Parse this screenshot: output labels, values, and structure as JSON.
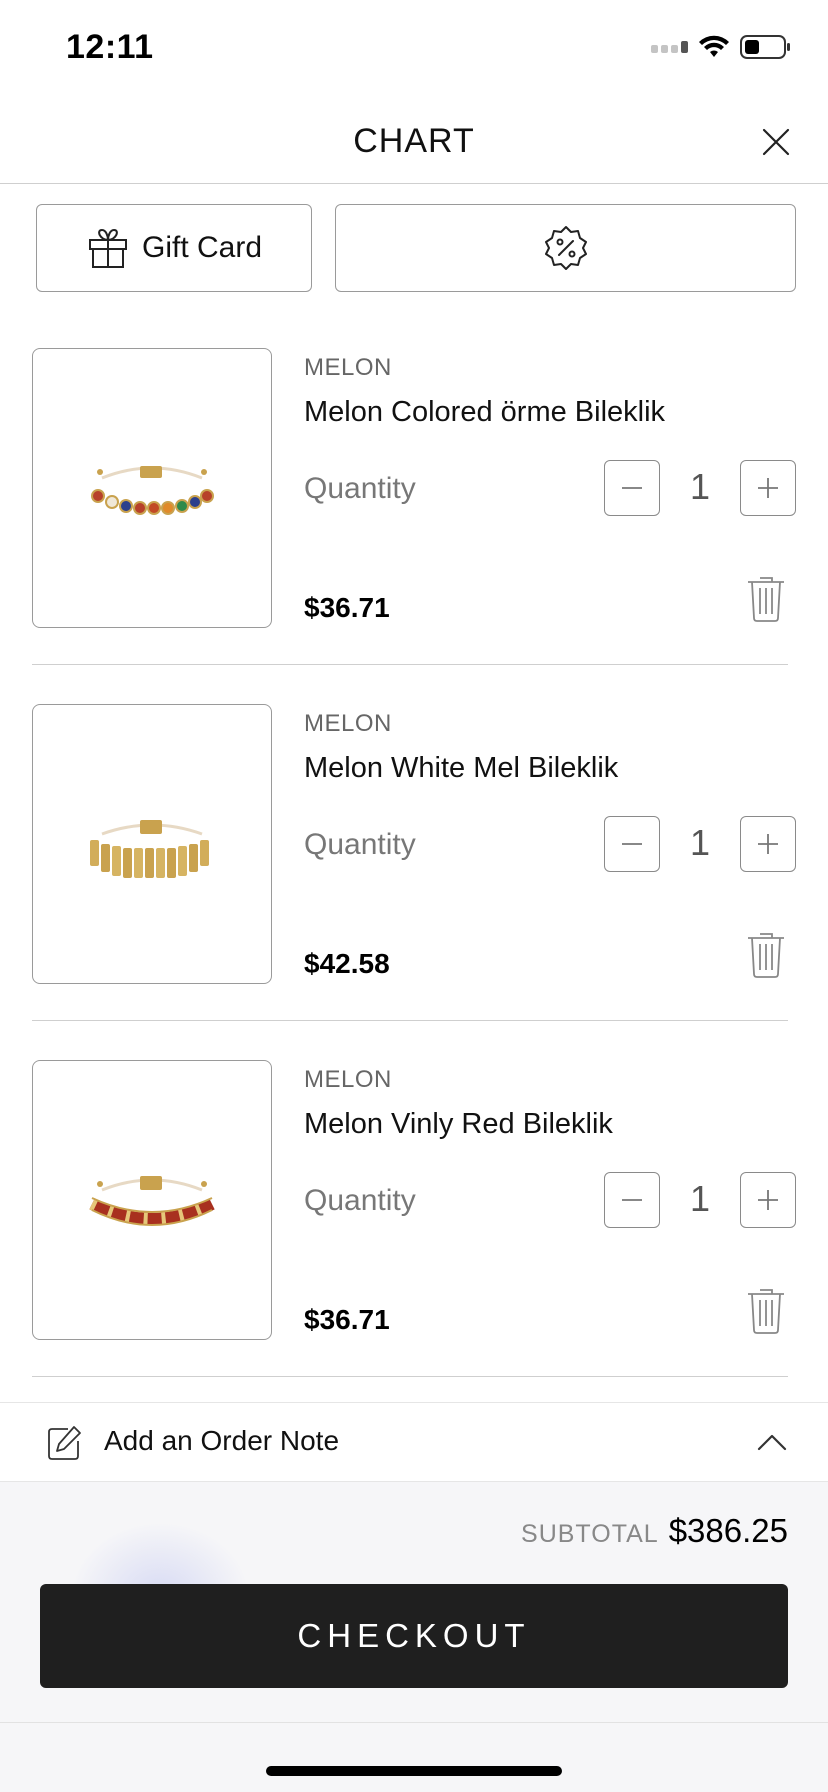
{
  "status_bar": {
    "time": "12:11"
  },
  "header": {
    "title": "CHART"
  },
  "promo": {
    "gift_card_label": "Gift Card"
  },
  "items": [
    {
      "brand": "MELON",
      "name": "Melon Colored örme Bileklik",
      "quantity_label": "Quantity",
      "quantity": "1",
      "price": "$36.71"
    },
    {
      "brand": "MELON",
      "name": "Melon White Mel Bileklik",
      "quantity_label": "Quantity",
      "quantity": "1",
      "price": "$42.58"
    },
    {
      "brand": "MELON",
      "name": "Melon Vinly Red Bileklik",
      "quantity_label": "Quantity",
      "quantity": "1",
      "price": "$36.71"
    }
  ],
  "order_note": {
    "label": "Add an Order Note"
  },
  "summary": {
    "subtotal_label": "SUBTOTAL",
    "subtotal_value": "$386.25",
    "checkout_label": "CHECKOUT"
  },
  "colors": {
    "checkout_bg": "#1f1f1f",
    "border": "#9a9a9a",
    "muted_text": "#777777"
  }
}
